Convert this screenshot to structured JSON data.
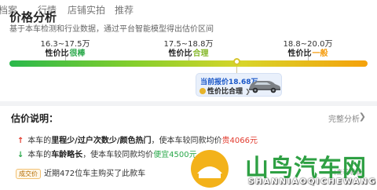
{
  "tabs": [
    "档案",
    "行情",
    "店铺",
    "实拍",
    "推荐"
  ],
  "header": {
    "title": "价格分析",
    "subtitle": "基于本车检测和行业数据，通过平台智能模型得出估价区间"
  },
  "price_bar": {
    "ranges": [
      {
        "label": "16.3~17.5万",
        "tier_prefix": "性价比",
        "tier_value": "很棒",
        "color": "#2aa84a"
      },
      {
        "label": "17.5~18.8万",
        "tier_prefix": "性价比",
        "tier_value": "合理",
        "color": "#86b82c"
      },
      {
        "label": "18.8~20.0万",
        "tier_prefix": "性价比",
        "tier_value": "一般",
        "color": "#f59b0b"
      }
    ],
    "current_price": "当前报价18.68万",
    "current_tier": "性价比合理",
    "current_tier_arrow": "❯",
    "car_icon": "car-image"
  },
  "analysis": {
    "title": "估价说明：",
    "link_label": "完整分析",
    "link_arrow": "❯",
    "reasons": [
      {
        "icon": "↑",
        "pre": "本车的",
        "bold": "里程少/过户次数少/颜色热门",
        "mid": "，使本车较同款均价",
        "value": "贵4066元"
      },
      {
        "icon": "↓",
        "pre": "本车的",
        "bold": "车龄略长",
        "mid": "，使本车较同款均价",
        "value": "便宜4500元"
      }
    ],
    "deal_badge": "成交价",
    "deal_text": "近期472位车主购买了此款车",
    "deal_link": "(查看明细)"
  },
  "watermark": {
    "cn": "山鸟汽车网",
    "en": "SHANNIAOQICHEWANG"
  },
  "colors": {
    "accent": "#1a57c8",
    "up": "#e23b2e",
    "down": "#2aa84a",
    "watermark": "#2ea043"
  }
}
